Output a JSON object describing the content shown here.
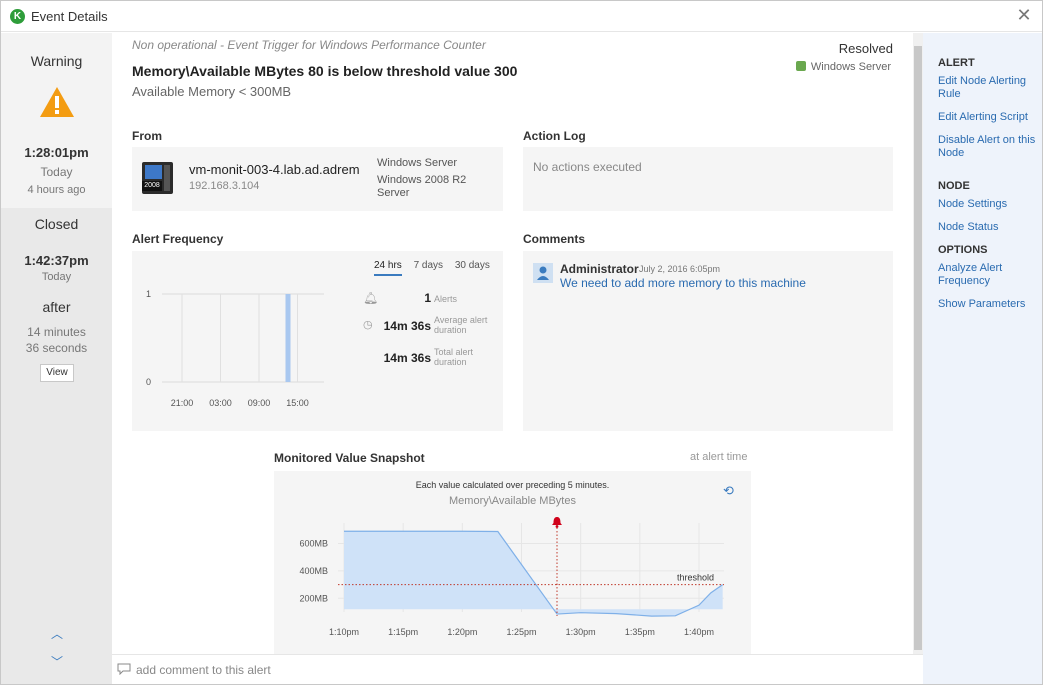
{
  "window": {
    "title": "Event Details",
    "logo": "K"
  },
  "left": {
    "state": "Warning",
    "open_time": "1:28:01pm",
    "open_day": "Today",
    "open_ago": "4 hours ago",
    "closed_label": "Closed",
    "closed_time": "1:42:37pm",
    "closed_day": "Today",
    "after_label": "after",
    "duration_line1": "14 minutes",
    "duration_line2": "36 seconds",
    "view_label": "View"
  },
  "header": {
    "trigger": "Non operational - Event Trigger for Windows Performance Counter",
    "title": "Memory\\Available MBytes 80 is below threshold value 300",
    "subtitle": "Available Memory < 300MB",
    "status": "Resolved",
    "node_type": "Windows Server"
  },
  "from": {
    "title": "From",
    "host": "vm-monit-003-4.lab.ad.adrem",
    "ip": "192.168.3.104",
    "os_line1": "Windows Server",
    "os_line2": "Windows 2008 R2 Server",
    "icon_badge": "2008"
  },
  "action_log": {
    "title": "Action Log",
    "empty_text": "No actions executed"
  },
  "alert_frequency": {
    "title": "Alert Frequency",
    "tabs": [
      "24 hrs",
      "7 days",
      "30 days"
    ],
    "active_tab": "24 hrs",
    "alerts_value": "1",
    "alerts_label": "Alerts",
    "avg_value": "14m 36s",
    "avg_label": "Average alert duration",
    "total_value": "14m 36s",
    "total_label": "Total alert duration"
  },
  "comments": {
    "title": "Comments",
    "items": [
      {
        "author": "Administrator",
        "date": "July 2, 2016 6:05pm",
        "text": "We need to add more memory to this machine"
      }
    ]
  },
  "snapshot": {
    "title": "Monitored Value Snapshot",
    "time_label": "at alert time",
    "note": "Each value calculated over preceding 5 minutes.",
    "series_name": "Memory\\Available MBytes",
    "threshold_label": "threshold"
  },
  "comment_input": {
    "placeholder": "add comment to this alert"
  },
  "sidebar": {
    "alert_head": "ALERT",
    "alert_links": [
      "Edit Node Alerting Rule",
      "Edit Alerting Script",
      "Disable Alert on this Node"
    ],
    "node_head": "NODE",
    "node_links": [
      "Node Settings",
      "Node Status"
    ],
    "options_head": "OPTIONS",
    "options_links": [
      "Analyze Alert Frequency",
      "Show Parameters"
    ]
  },
  "colors": {
    "accent": "#3a7bbf",
    "warning": "#f39c12",
    "bar": "#a9c8f0",
    "threshold": "#c0392b",
    "area": "#cfe2f8"
  },
  "chart_data": [
    {
      "type": "bar",
      "title": "",
      "x": [
        "21:00",
        "03:00",
        "09:00",
        "15:00"
      ],
      "yticks": [
        0,
        1
      ],
      "ylim": [
        0,
        1
      ],
      "series": [
        {
          "values": [
            {
              "x": "15:00",
              "y": 1
            }
          ]
        }
      ],
      "grid": true
    },
    {
      "type": "area",
      "title": "Memory\\Available MBytes",
      "x": [
        "1:10pm",
        "1:15pm",
        "1:20pm",
        "1:25pm",
        "1:30pm",
        "1:35pm",
        "1:40pm"
      ],
      "yticks": [
        "200MB",
        "400MB",
        "600MB"
      ],
      "ylim": [
        100,
        750
      ],
      "threshold": 300,
      "alert_time": "1:28pm",
      "series": [
        {
          "name": "Memory\\Available MBytes",
          "points": [
            [
              "1:10pm",
              690
            ],
            [
              "1:15pm",
              690
            ],
            [
              "1:20pm",
              690
            ],
            [
              "1:23pm",
              688
            ],
            [
              "1:28pm",
              85
            ],
            [
              "1:30pm",
              95
            ],
            [
              "1:33pm",
              88
            ],
            [
              "1:36pm",
              70
            ],
            [
              "1:38pm",
              72
            ],
            [
              "1:40pm",
              150
            ],
            [
              "1:41pm",
              240
            ],
            [
              "1:42pm",
              300
            ]
          ]
        }
      ],
      "grid": true
    }
  ]
}
